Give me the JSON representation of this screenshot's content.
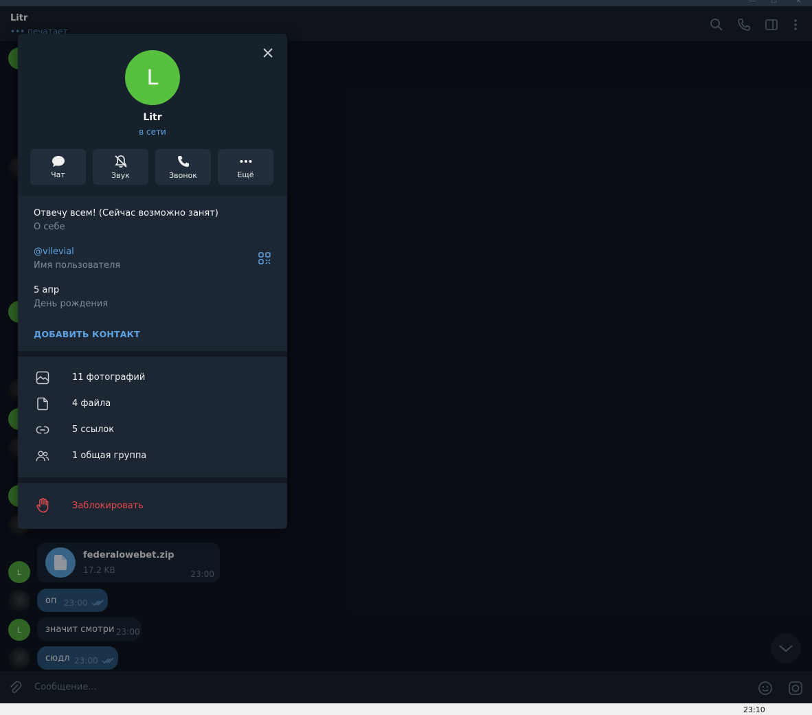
{
  "header": {
    "name": "Litr",
    "status": "••• печатает"
  },
  "messages": [
    {
      "text": "оп",
      "time": "23:00"
    },
    {
      "text": "значит смотри",
      "time": "23:00"
    },
    {
      "text": "сюдл",
      "time": "23:00"
    }
  ],
  "file": {
    "name": "federalowebet.zip",
    "size": "17.2 KB",
    "time": "23:00"
  },
  "avatar_letter": "L",
  "input": {
    "placeholder": "Сообщение..."
  },
  "taskbar": {
    "clock": "23:10"
  },
  "profile": {
    "avatar_letter": "L",
    "name": "Litr",
    "status": "в сети",
    "actions": [
      {
        "label": "Чат",
        "icon": "chat-icon"
      },
      {
        "label": "Звук",
        "icon": "bell-off-icon"
      },
      {
        "label": "Звонок",
        "icon": "phone-icon"
      },
      {
        "label": "Ещё",
        "icon": "more-icon"
      }
    ],
    "bio": {
      "value": "Отвечу всем! (Сейчас возможно занят)",
      "label": "О себе"
    },
    "username": {
      "value": "@vilevial",
      "label": "Имя пользователя"
    },
    "birthday": {
      "value": "5 апр",
      "label": "День рождения"
    },
    "add_contact": "ДОБАВИТЬ КОНТАКТ",
    "media": [
      {
        "text": "11 фотографий",
        "icon": "photo-icon"
      },
      {
        "text": "4 файла",
        "icon": "file-icon"
      },
      {
        "text": "5 ссылок",
        "icon": "link-icon"
      },
      {
        "text": "1 общая группа",
        "icon": "group-icon"
      }
    ],
    "block": "Заблокировать"
  },
  "colors": {
    "accent": "#5ea3e3",
    "danger": "#e5484d",
    "avatar_green": "#57c13f",
    "bg": "#0e1621",
    "panel": "#17212b"
  }
}
